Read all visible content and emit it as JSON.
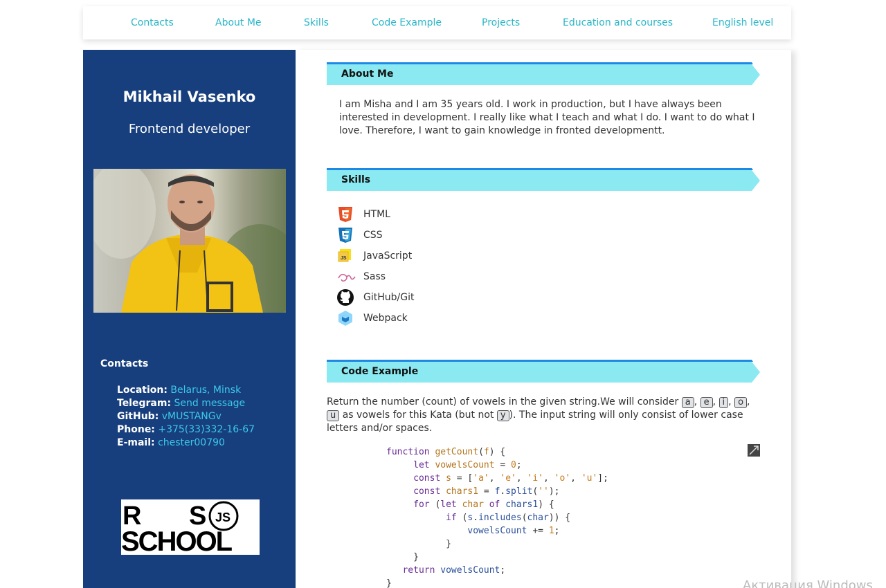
{
  "nav": {
    "items": [
      "Contacts",
      "About Me",
      "Skills",
      "Code Example",
      "Projects",
      "Education and courses",
      "English level"
    ]
  },
  "sidebar": {
    "name": "Mikhail Vasenko",
    "role": "Frontend developer",
    "contacts_title": "Contacts",
    "contacts": [
      {
        "label": "Location:",
        "value": "Belarus, Minsk"
      },
      {
        "label": "Telegram:",
        "value": "Send message"
      },
      {
        "label": "GitHub:",
        "value": "vMUSTANGv"
      },
      {
        "label": "Phone:",
        "value": "+375(33)332-16-67"
      },
      {
        "label": "E-mail:",
        "value": "chester00790"
      }
    ],
    "logo_text": {
      "top_left": "R",
      "top_right": "S",
      "badge": "JS",
      "bottom": "SCHOOL"
    }
  },
  "about": {
    "title": "About Me",
    "text": "I am Misha and I am 35 years old. I work in production, but I have always been interested in development. I really like what I teach and what I do. I want to do what I love. Therefore, I want to gain knowledge in fronted developmentt."
  },
  "skills": {
    "title": "Skills",
    "items": [
      {
        "label": "HTML",
        "icon": "html5-icon"
      },
      {
        "label": "CSS",
        "icon": "css3-icon"
      },
      {
        "label": "JavaScript",
        "icon": "javascript-icon"
      },
      {
        "label": "Sass",
        "icon": "sass-icon"
      },
      {
        "label": "GitHub/Git",
        "icon": "github-icon"
      },
      {
        "label": "Webpack",
        "icon": "webpack-icon"
      }
    ]
  },
  "code_example": {
    "title": "Code Example",
    "intro_1": "Return the number (count) of vowels in the given string.We will consider",
    "vowels": [
      "a",
      "e",
      "i",
      "o",
      "u"
    ],
    "intro_2": "as vowels for this Kata (but not",
    "not_vowel": "y",
    "intro_3": "). The input string will only consist of lower case letters and/or spaces."
  },
  "watermark": "Активация Windows",
  "colors": {
    "sidebar": "#173f7d",
    "accent": "#29b6c8",
    "header_band": "#8ae9f1",
    "header_top": "#1e88e5"
  }
}
